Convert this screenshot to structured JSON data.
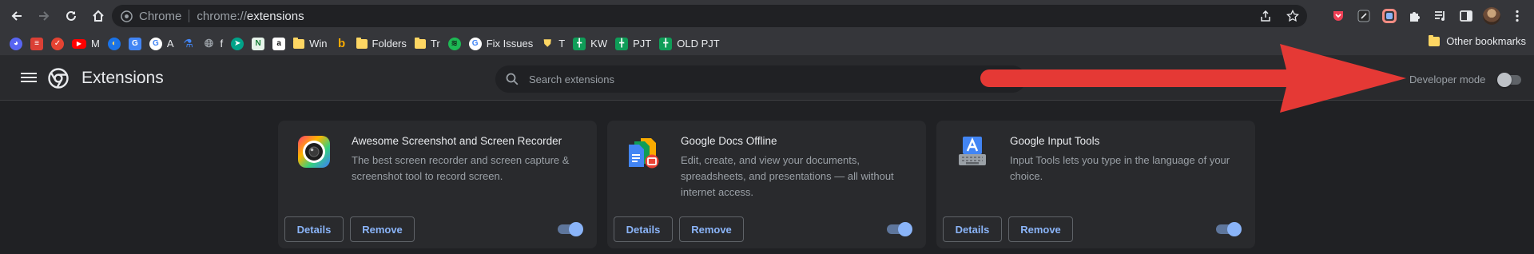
{
  "colors": {
    "accent": "#8ab4f8",
    "arrow": "#e53935",
    "background": "#202124"
  },
  "toolbar": {
    "site_name": "Chrome",
    "url_scheme": "chrome://",
    "url_path": "extensions",
    "icons": [
      "back-icon",
      "forward-icon",
      "reload-icon",
      "home-icon",
      "share-icon",
      "star-icon",
      "pocket-icon",
      "extension-icon",
      "colorful-extension-icon",
      "puzzle-icon",
      "media-icon",
      "side-panel-icon",
      "avatar",
      "kebab-menu-icon"
    ]
  },
  "bookmarks": {
    "items": [
      {
        "label": "",
        "icon": "discord-icon"
      },
      {
        "label": "",
        "icon": "todoist-icon"
      },
      {
        "label": "",
        "icon": "check-icon"
      },
      {
        "label": "M",
        "icon": "youtube-icon"
      },
      {
        "label": "",
        "icon": "yahoo-icon"
      },
      {
        "label": "",
        "icon": "translate-icon"
      },
      {
        "label": "A",
        "icon": "google-icon"
      },
      {
        "label": "",
        "icon": "flask-icon"
      },
      {
        "label": "f",
        "icon": "globe-icon"
      },
      {
        "label": "",
        "icon": "bird-icon"
      },
      {
        "label": "",
        "icon": "notion-n-icon"
      },
      {
        "label": "",
        "icon": "amazon-icon"
      },
      {
        "label": "Win",
        "icon": "folder-icon"
      },
      {
        "label": "",
        "icon": "b-icon"
      },
      {
        "label": "Folders",
        "icon": "folder-icon"
      },
      {
        "label": "Tr",
        "icon": "folder-icon"
      },
      {
        "label": "",
        "icon": "spotify-icon"
      },
      {
        "label": "Fix Issues",
        "icon": "google-icon"
      },
      {
        "label": "T",
        "icon": "shield-icon"
      },
      {
        "label": "KW",
        "icon": "sheets-icon"
      },
      {
        "label": "PJT",
        "icon": "sheets-icon"
      },
      {
        "label": "OLD PJT",
        "icon": "sheets-icon"
      }
    ],
    "other": "Other bookmarks"
  },
  "header": {
    "title": "Extensions",
    "search_placeholder": "Search extensions",
    "dev_mode_label": "Developer mode",
    "dev_mode_on": false
  },
  "extensions": [
    {
      "name": "Awesome Screenshot and Screen Recorder",
      "desc": "The best screen recorder and screen capture & screenshot tool to record screen.",
      "icon": "camera-lens-icon",
      "enabled": true,
      "details_label": "Details",
      "remove_label": "Remove"
    },
    {
      "name": "Google Docs Offline",
      "desc": "Edit, create, and view your documents, spreadsheets, and presentations — all without internet access.",
      "icon": "docs-offline-icon",
      "enabled": true,
      "details_label": "Details",
      "remove_label": "Remove"
    },
    {
      "name": "Google Input Tools",
      "desc": "Input Tools lets you type in the language of your choice.",
      "icon": "input-tools-icon",
      "enabled": true,
      "details_label": "Details",
      "remove_label": "Remove"
    }
  ]
}
